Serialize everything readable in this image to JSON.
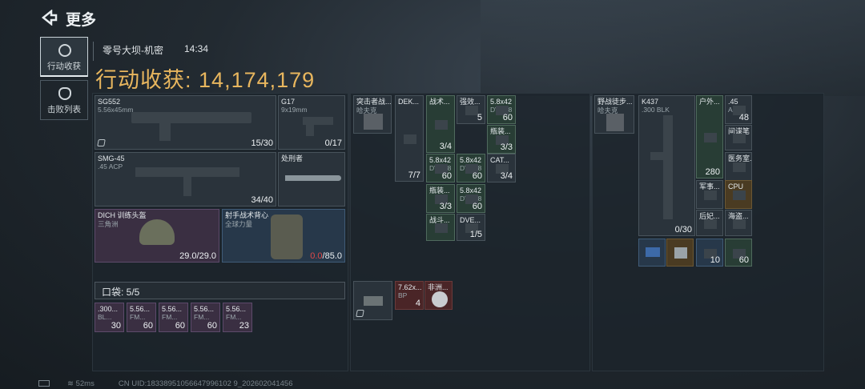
{
  "header": {
    "title": "更多"
  },
  "tabs": [
    {
      "label": "行动收获",
      "active": true
    },
    {
      "label": "击败列表",
      "active": false
    }
  ],
  "info": {
    "map": "零号大坝-机密",
    "time": "14:34"
  },
  "haul": {
    "label": "行动收获:",
    "value": "14,174,179"
  },
  "loadout": {
    "primary": {
      "name": "SG552",
      "ammo": "5.56x45mm",
      "count": "15/30"
    },
    "sidearm": {
      "name": "G17",
      "ammo": "9x19mm",
      "count": "0/17"
    },
    "secondary": {
      "name": "SMG-45",
      "ammo": ".45 ACP",
      "count": "34/40"
    },
    "melee": {
      "name": "处刑者"
    },
    "helmet": {
      "name": "DICH 训练头盔",
      "sub": "三角洲",
      "durability": "29.0/29.0"
    },
    "armor": {
      "name": "射手战术背心",
      "sub": "全球力量",
      "durability_cur": "0.0",
      "durability_max": "/85.0"
    }
  },
  "pocket": {
    "label": "口袋: 5/5",
    "items": [
      {
        "name": ".300...",
        "sub": "BL...",
        "qty": "30"
      },
      {
        "name": "5.56...",
        "sub": "FM...",
        "qty": "60"
      },
      {
        "name": "5.56...",
        "sub": "FM...",
        "qty": "60"
      },
      {
        "name": "5.56...",
        "sub": "FM...",
        "qty": "60"
      },
      {
        "name": "5.56...",
        "sub": "FM...",
        "qty": "23"
      }
    ]
  },
  "chest_rig": {
    "name": "突击者战...",
    "sub": "哈夫克"
  },
  "rig_items": [
    {
      "name": "DEK...",
      "qty": "7/7"
    },
    {
      "name": "战术...",
      "qty": "3/4"
    },
    {
      "name": "强效...",
      "qty": "5"
    },
    {
      "name": "5.8x42",
      "sub": "DVC88",
      "qty": "60"
    },
    {
      "name": "瓶装...",
      "qty": "3/3"
    },
    {
      "name": "5.8x42",
      "sub": "DVC88",
      "qty": "60"
    },
    {
      "name": "5.8x42",
      "sub": "DVC88",
      "qty": "60"
    },
    {
      "name": "CAT...",
      "qty": "3/4"
    },
    {
      "name": "瓶装...",
      "qty": "3/3"
    },
    {
      "name": "5.8x42",
      "sub": "DVC88",
      "qty": "60"
    },
    {
      "name": "战斗...",
      "qty": ""
    },
    {
      "name": "DVE...",
      "qty": "1/5"
    }
  ],
  "bag": {
    "name": "7.62x...",
    "sub": "BP",
    "qty": "4"
  },
  "misc": {
    "name": "非洲..."
  },
  "backpack": {
    "name": "野战徒步...",
    "sub": "哈夫克"
  },
  "stash_gun": {
    "name": "K437",
    "ammo": ".300 BLK",
    "count": "0/30"
  },
  "stash_items": [
    {
      "name": "户外...",
      "qty": "280"
    },
    {
      "name": ".45",
      "sub": "AC...",
      "qty": "48"
    },
    {
      "name": "间谍笔",
      "qty": ""
    },
    {
      "name": "医务室...",
      "qty": ""
    },
    {
      "name": "军事...",
      "qty": ""
    },
    {
      "name": "CPU",
      "qty": ""
    },
    {
      "name": "后妃...",
      "qty": ""
    },
    {
      "name": "海盗...",
      "qty": ""
    },
    {
      "name": "",
      "qty": "10"
    },
    {
      "name": "",
      "qty": "60"
    }
  ],
  "status": {
    "ping": "52ms",
    "uid": "CN UID:18338951056647996102 9_202602041456"
  }
}
